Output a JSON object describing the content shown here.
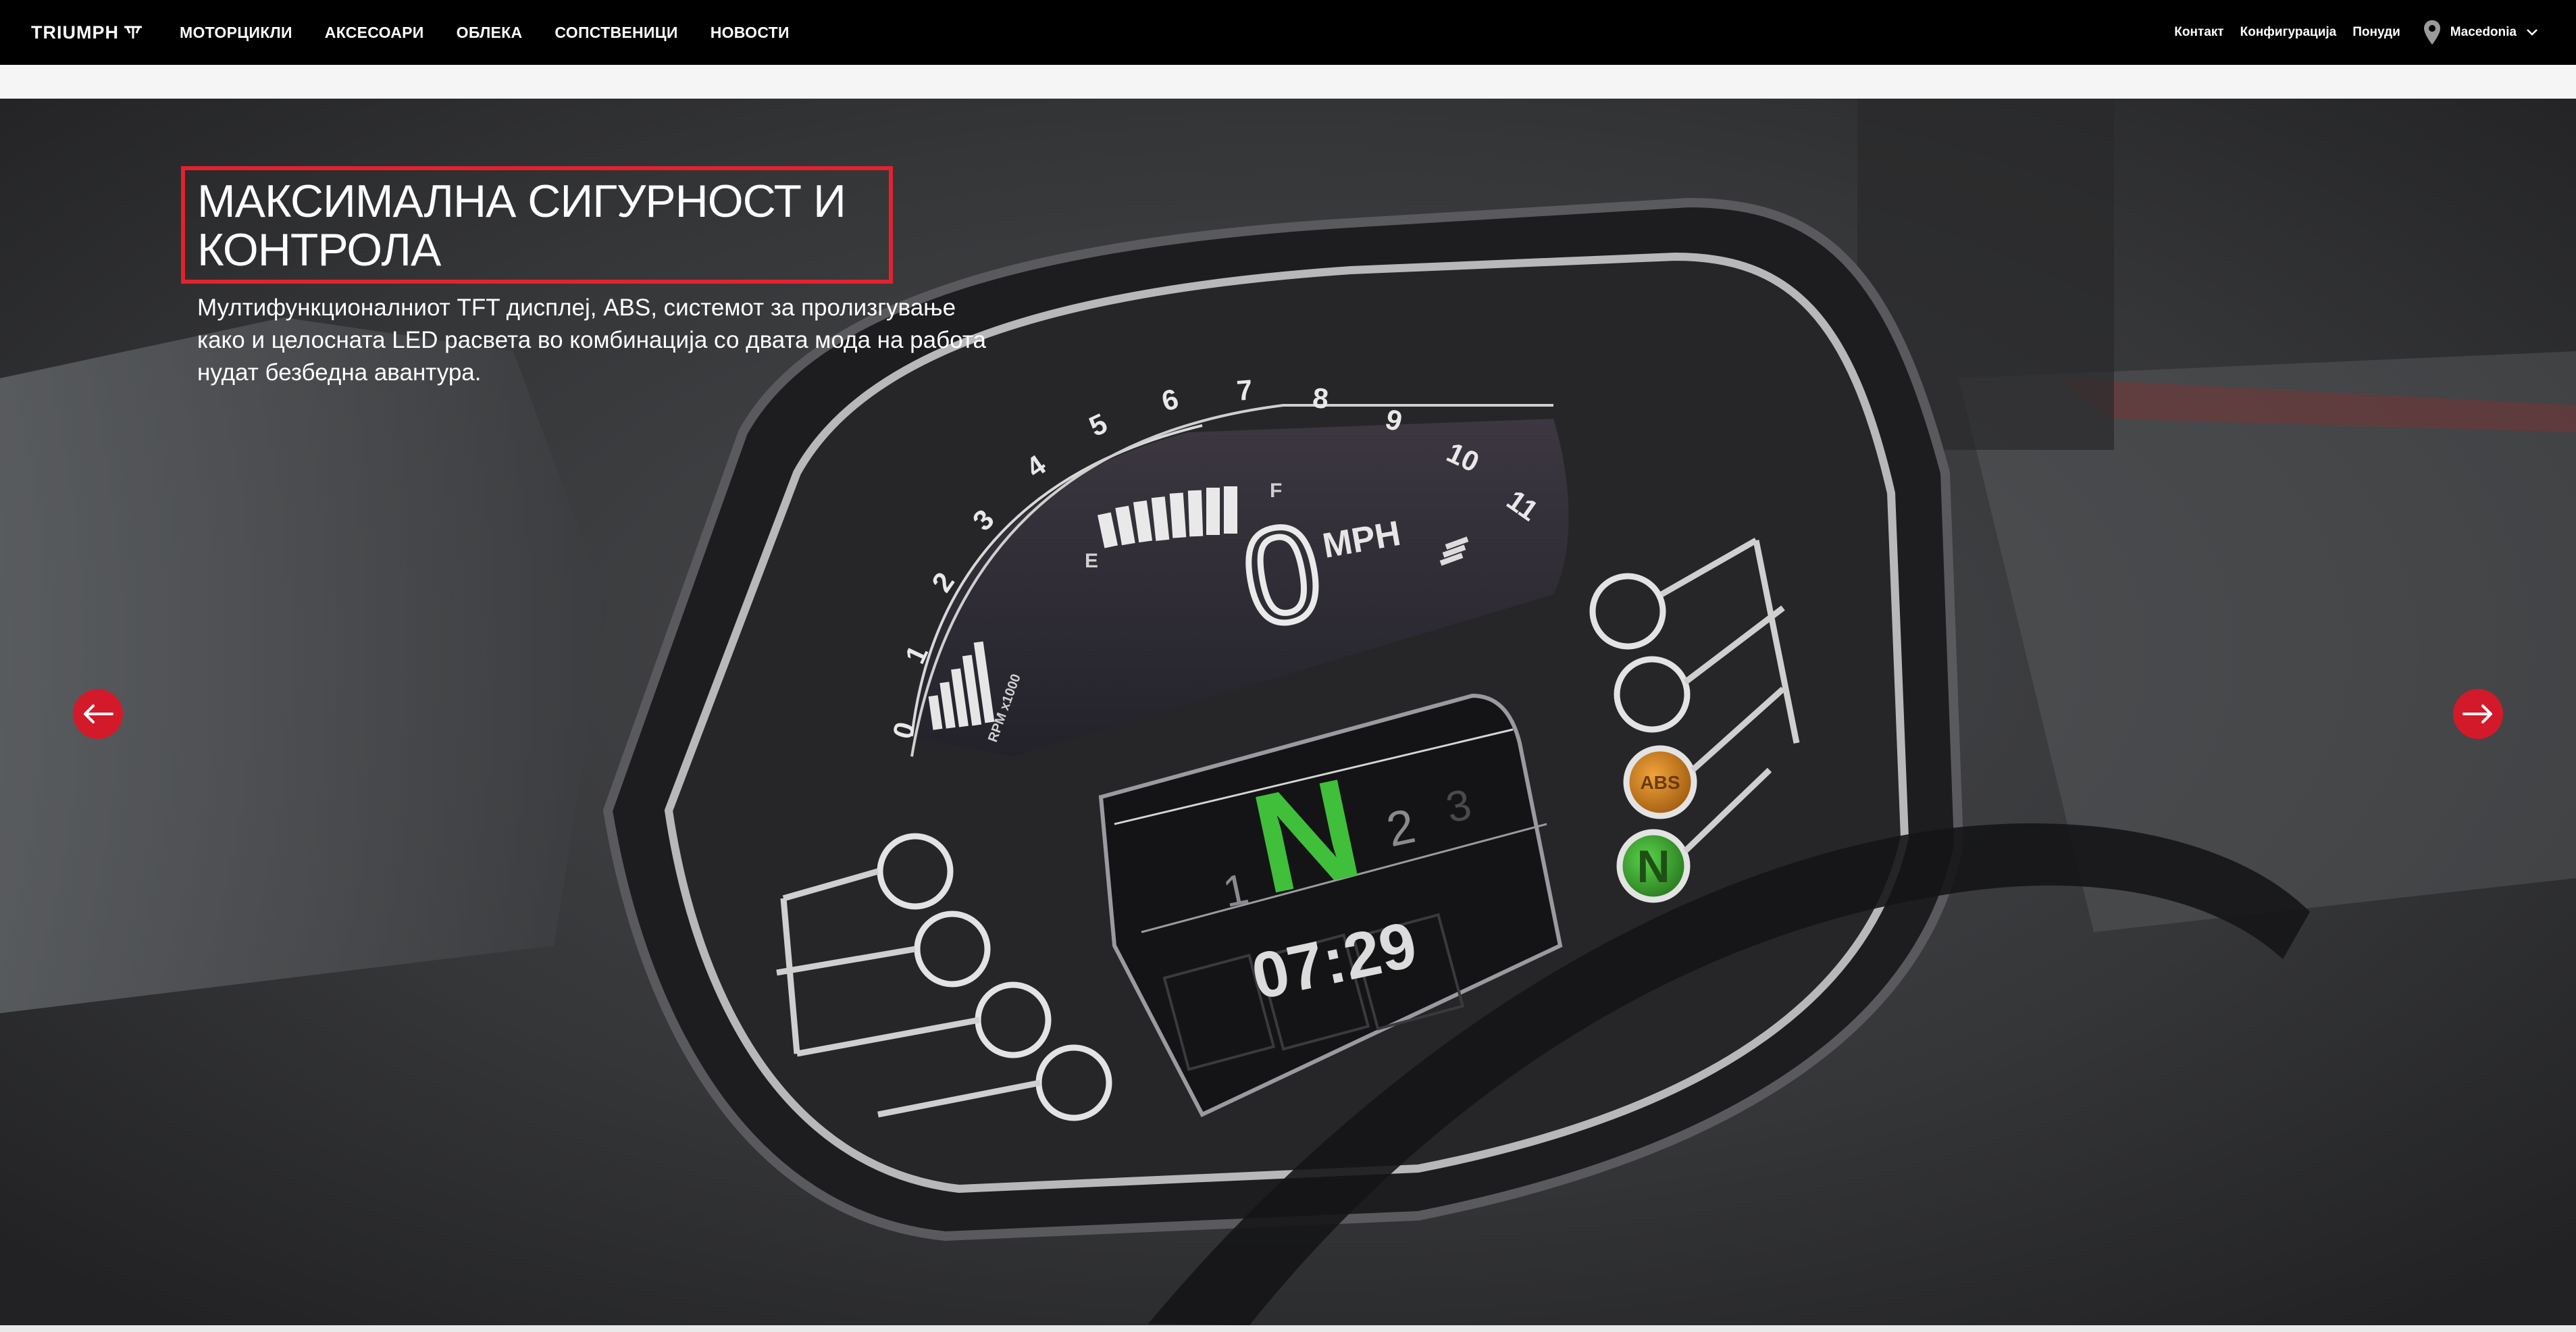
{
  "brand": {
    "logo_text": "TRIUMPH"
  },
  "main_nav": [
    {
      "label": "МОТОРЦИКЛИ"
    },
    {
      "label": "АКСЕСОАРИ"
    },
    {
      "label": "ОБЛЕКА"
    },
    {
      "label": "СОПСТВЕНИЦИ"
    },
    {
      "label": "НОВОСТИ"
    }
  ],
  "util_nav": {
    "contact": "Контакт",
    "configure": "Конфигурација",
    "offers": "Понуди",
    "country": "Macedonia"
  },
  "hero": {
    "headline_line1": "МАКСИМАЛНА СИГУРНОСТ И",
    "headline_line2": "КОНТРОЛА",
    "sub_line1": "Мултифункционалниот TFT дисплеј, ABS, системот за пролизгување",
    "sub_line2": "како и целосната LED расвета во комбинација со двата мода на работа",
    "sub_line3": "нудат безбедна авантура."
  },
  "dashboard": {
    "rpm_ticks": [
      "0",
      "1",
      "2",
      "3",
      "4",
      "5",
      "6",
      "7",
      "8",
      "9",
      "10",
      "11"
    ],
    "rpm_label": "RPM x1000",
    "speed": "0",
    "speed_unit": "MPH",
    "fuel_empty": "E",
    "fuel_full": "F",
    "gear": "N",
    "gear_prev": "1",
    "gear_next": "2",
    "gear_next2": "3",
    "clock": "07:29",
    "abs_label": "ABS",
    "neutral_label": "N"
  },
  "colors": {
    "accent_red": "#d31a2a",
    "headline_border": "#e3222e",
    "gear_green": "#3fbf3a",
    "abs_amber": "#d98a1f"
  },
  "icons": {
    "prev": "arrow-left-icon",
    "next": "arrow-right-icon",
    "location": "location-pin-icon",
    "dropdown": "chevron-down-icon"
  }
}
